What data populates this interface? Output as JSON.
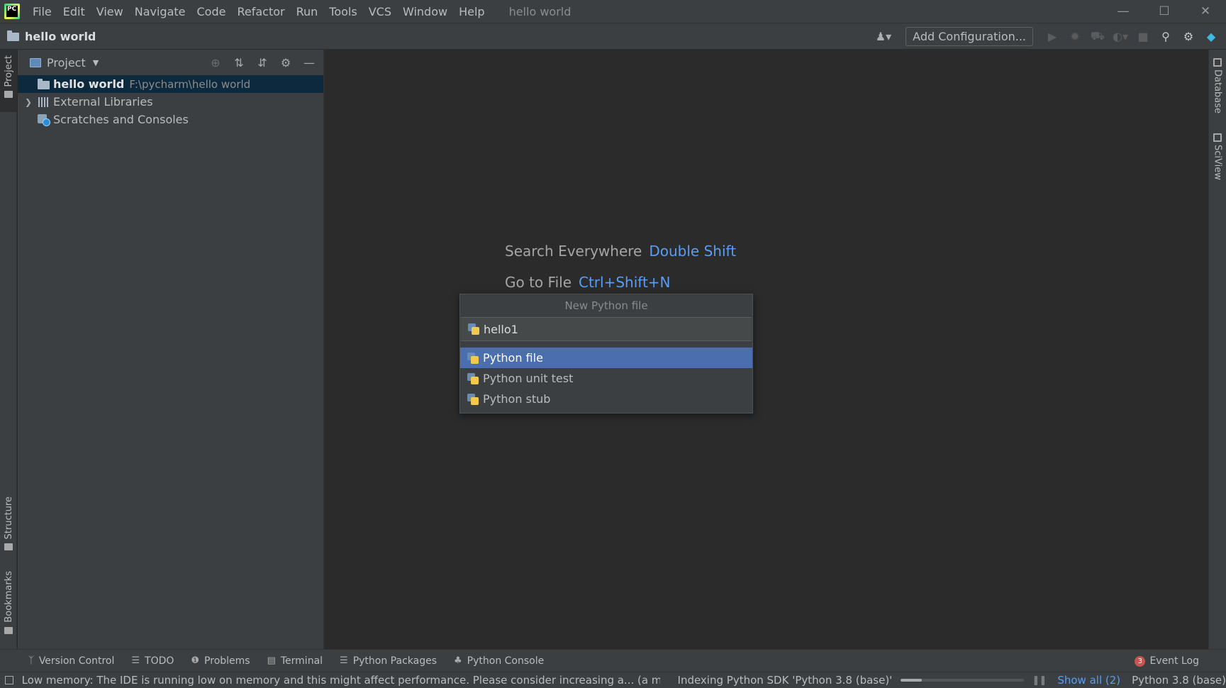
{
  "menubar": {
    "items": [
      "File",
      "Edit",
      "View",
      "Navigate",
      "Code",
      "Refactor",
      "Run",
      "Tools",
      "VCS",
      "Window",
      "Help"
    ],
    "window_title": "hello world"
  },
  "navbar": {
    "breadcrumb": "hello world",
    "add_configuration": "Add Configuration..."
  },
  "left_stripe": {
    "project": "Project",
    "structure": "Structure",
    "bookmarks": "Bookmarks"
  },
  "right_stripe": {
    "database": "Database",
    "sciview": "SciView"
  },
  "project_panel": {
    "title": "Project",
    "tree": [
      {
        "label": "hello world",
        "path": "F:\\pycharm\\hello world"
      },
      {
        "label": "External Libraries"
      },
      {
        "label": "Scratches and Consoles"
      }
    ]
  },
  "editor": {
    "hints": [
      {
        "label": "Search Everywhere",
        "key": "Double Shift"
      },
      {
        "label": "Go to File",
        "key": "Ctrl+Shift+N"
      }
    ]
  },
  "new_file_popup": {
    "title": "New Python file",
    "input_value": "hello1",
    "options": [
      "Python file",
      "Python unit test",
      "Python stub"
    ],
    "selected_index": 0
  },
  "bottom_tools": {
    "items": [
      {
        "label": "Version Control",
        "icon": "branch-icon"
      },
      {
        "label": "TODO",
        "icon": "list-icon"
      },
      {
        "label": "Problems",
        "icon": "info-icon"
      },
      {
        "label": "Terminal",
        "icon": "terminal-icon"
      },
      {
        "label": "Python Packages",
        "icon": "packages-icon"
      },
      {
        "label": "Python Console",
        "icon": "python-console-icon"
      }
    ],
    "event_log": "Event Log",
    "event_count": "3"
  },
  "statusbar": {
    "message": "Low memory: The IDE is running low on memory and this might affect performance. Please consider increasing a... (a minute ag",
    "indexing": "Indexing Python SDK 'Python 3.8 (base)'",
    "progress": 0.17,
    "show_all": "Show all (2)",
    "interpreter": "Python 3.8 (base)"
  },
  "colors": {
    "accent_blue": "#589df6",
    "selection": "#4b6eaf",
    "tree_selection": "#0d293e",
    "badge_red": "#c75450"
  }
}
